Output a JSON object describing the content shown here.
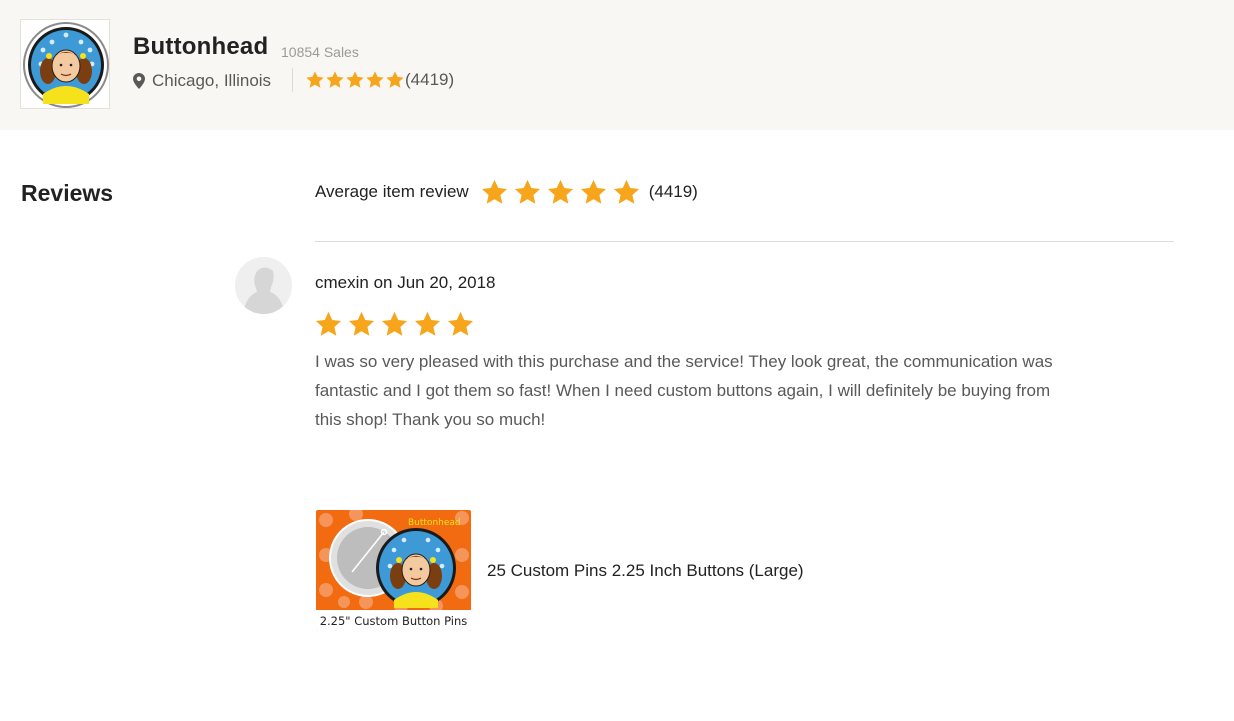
{
  "shop": {
    "name": "Buttonhead",
    "sales": "10854 Sales",
    "location": "Chicago, Illinois",
    "rating_stars": 5,
    "rating_count": "(4419)",
    "logo_icon": "buttonhead-logo"
  },
  "reviews": {
    "heading": "Reviews",
    "average_label": "Average item review",
    "average_stars": 5,
    "average_count": "(4419)"
  },
  "review": {
    "reviewer_line": "cmexin on Jun 20, 2018",
    "avatar_icon": "default-avatar-icon",
    "stars": 5,
    "text": "I was so very pleased with this purchase and the service! They look great, the communication was fantastic and I got them so fast! When I need custom buttons again, I will definitely be buying from this shop! Thank you so much!",
    "product_title": "25 Custom Pins 2.25 Inch Buttons (Large)",
    "product_image_caption": "2.25\" Custom Button Pins",
    "product_image_brand": "Buttonhead"
  },
  "colors": {
    "star": "#f7a51b",
    "header_bg": "#f8f7f3",
    "product_orange": "#f26b10"
  }
}
